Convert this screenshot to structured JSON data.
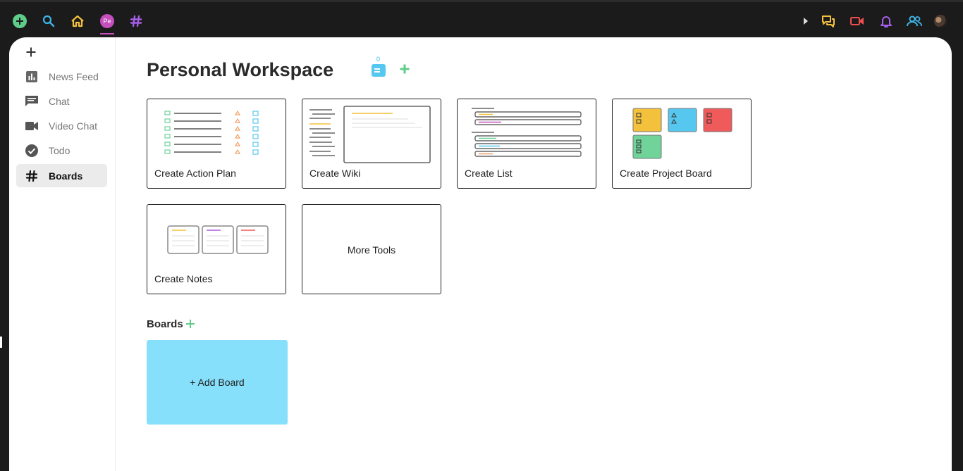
{
  "topbar": {
    "left_icons": [
      "plus-circle-icon",
      "search-icon",
      "home-icon",
      "profile-avatar",
      "hash-icon"
    ],
    "avatar_initials": "Pe",
    "right_icons": [
      "caret-right-icon",
      "chat-bubbles-icon",
      "video-camera-icon",
      "bell-icon",
      "people-icon",
      "user-photo-avatar"
    ],
    "colors": {
      "add": "#5fcd8a",
      "search": "#3fb5e8",
      "home": "#f3c13c",
      "avatar": "#c44fbd",
      "hash": "#a55ee6",
      "chat": "#f3c13c",
      "video": "#ef4e4e",
      "bell": "#a55ee6",
      "people": "#3fb5e8"
    }
  },
  "sidebar": {
    "items": [
      {
        "label": "News Feed",
        "icon": "bar-chart-icon"
      },
      {
        "label": "Chat",
        "icon": "chat-icon"
      },
      {
        "label": "Video Chat",
        "icon": "video-icon"
      },
      {
        "label": "Todo",
        "icon": "check-circle-icon"
      },
      {
        "label": "Boards",
        "icon": "hash-icon",
        "active": true
      }
    ]
  },
  "workspace": {
    "title": "Personal Workspace",
    "doc_count": "0"
  },
  "tools": [
    {
      "label": "Create Action Plan"
    },
    {
      "label": "Create Wiki"
    },
    {
      "label": "Create List"
    },
    {
      "label": "Create Project Board"
    },
    {
      "label": "Create Notes"
    },
    {
      "label": "More Tools"
    }
  ],
  "boards": {
    "heading": "Boards",
    "add_board_label": "+ Add Board"
  }
}
